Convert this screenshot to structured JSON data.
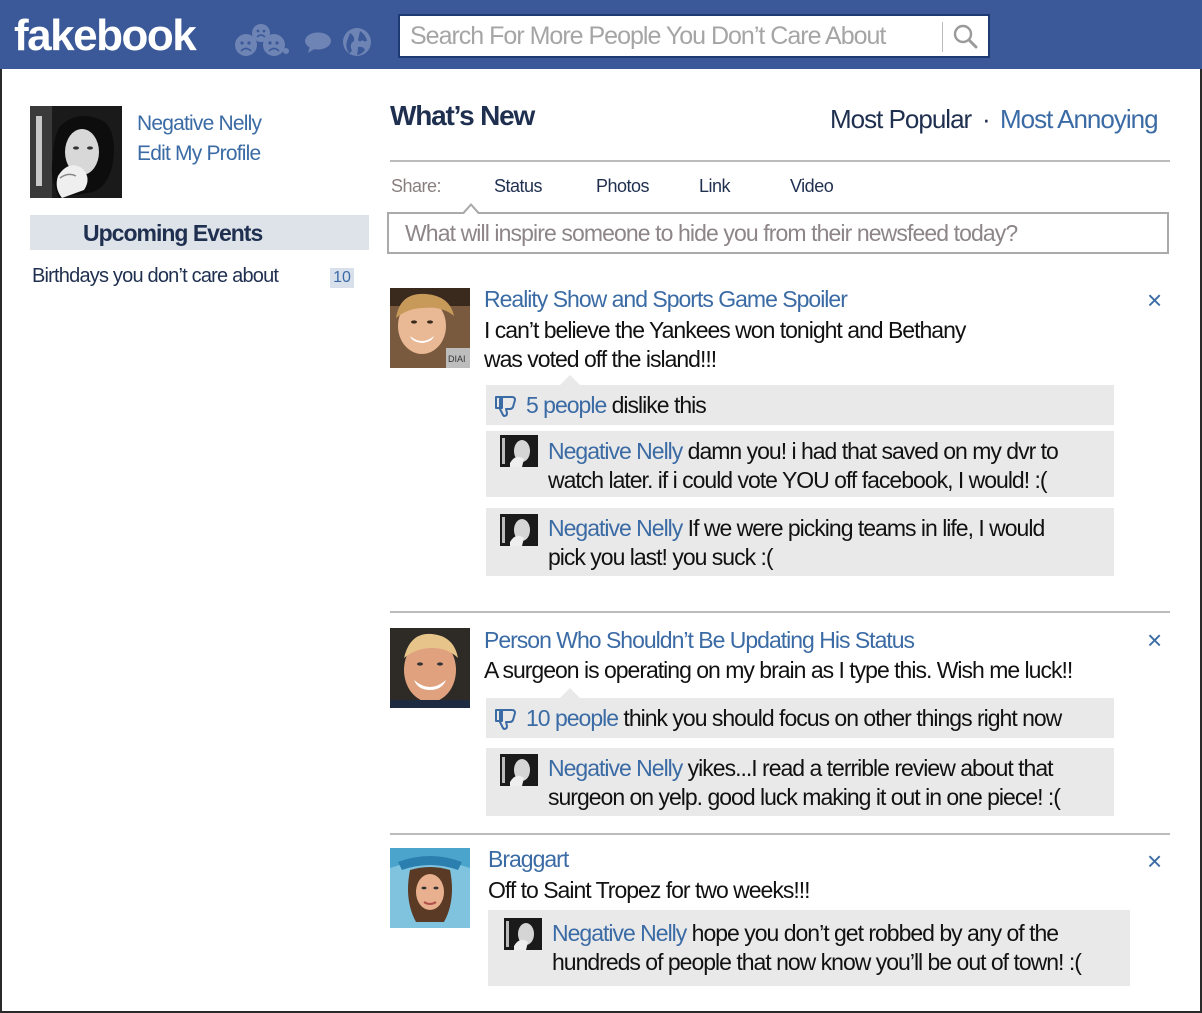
{
  "app": {
    "logo": "fakebook"
  },
  "search": {
    "placeholder": "Search For More People You Don’t Care About"
  },
  "sidebar": {
    "profile_name": "Negative Nelly",
    "edit_profile": "Edit My Profile",
    "events_heading": "Upcoming Events",
    "birthdays_label": "Birthdays you don’t care about",
    "birthdays_count": "10"
  },
  "feed_header": {
    "title": "What’s New",
    "filter_popular": "Most Popular",
    "separator": "·",
    "filter_annoying": "Most Annoying"
  },
  "share": {
    "label": "Share:",
    "tabs": [
      "Status",
      "Photos",
      "Link",
      "Video"
    ],
    "composer_placeholder": "What will inspire someone to hide you from their newsfeed today?"
  },
  "posts": [
    {
      "author": "Reality Show and Sports Game Spoiler",
      "text_line1": "I can’t believe the Yankees won tonight and Bethany",
      "text_line2": "was voted off the island!!!",
      "dislike_link": "5 people",
      "dislike_rest": " dislike this",
      "comments": [
        {
          "author": "Negative Nelly",
          "line1": " damn you! i had that saved on my dvr to",
          "line2": "watch later. if i could vote YOU off facebook, I would! :("
        },
        {
          "author": "Negative Nelly",
          "line1": " If we were picking teams in life, I would",
          "line2": "pick you last! you suck :("
        }
      ]
    },
    {
      "author": "Person Who Shouldn’t Be Updating His Status",
      "text_line1": "A surgeon is operating on my brain as I type this. Wish me luck!!",
      "dislike_link": "10 people",
      "dislike_rest": " think you should focus on other things right now",
      "comments": [
        {
          "author": "Negative Nelly",
          "line1": " yikes...I read a terrible review about that",
          "line2": "surgeon on yelp. good luck making it out in one piece! :("
        }
      ]
    },
    {
      "author": "Braggart",
      "text_line1": "Off to Saint Tropez for two weeks!!!",
      "comments": [
        {
          "author": "Negative Nelly",
          "line1": " hope you don’t get robbed by any of the",
          "line2": "hundreds of people that now know you’ll be out of town! :("
        }
      ]
    }
  ],
  "close_symbol": "×",
  "colors": {
    "topbar": "#3b5998",
    "link": "#3b6ba5",
    "heading": "#1f2f4f",
    "comment_bg": "#e9e9e9"
  },
  "icons": [
    "sad-face-icon",
    "chat-bubble-icon",
    "globe-icon",
    "search-icon",
    "thumbs-down-icon",
    "close-icon"
  ]
}
